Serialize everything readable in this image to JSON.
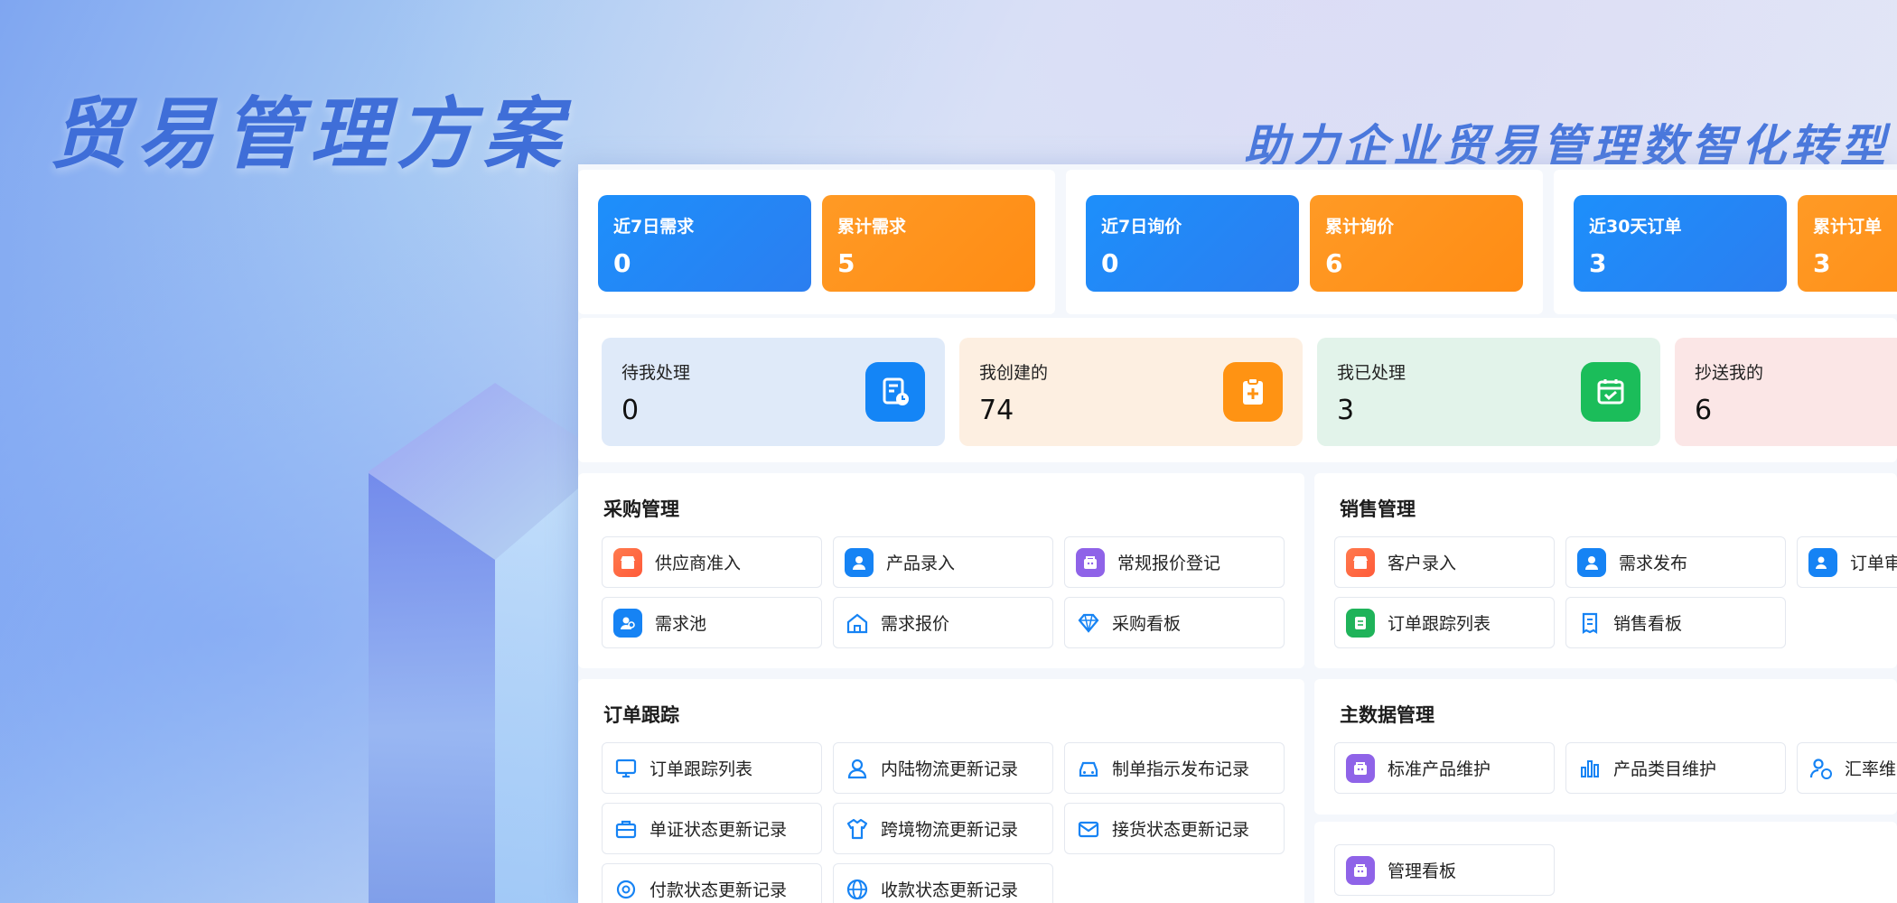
{
  "hero": {
    "title": "贸易管理方案",
    "subtitle": "助力企业贸易管理数智化转型"
  },
  "stats": [
    {
      "label": "近7日需求",
      "value": "0",
      "color": "#1d8ffb"
    },
    {
      "label": "累计需求",
      "value": "5",
      "color": "#ff9a25"
    },
    {
      "label": "近7日询价",
      "value": "0",
      "color": "#1d8ffb"
    },
    {
      "label": "累计询价",
      "value": "6",
      "color": "#ff9a25"
    },
    {
      "label": "近30天订单",
      "value": "3",
      "color": "#1d8ffb"
    },
    {
      "label": "累计订单",
      "value": "3",
      "color": "#ff9a25"
    }
  ],
  "tasks": [
    {
      "label": "待我处理",
      "value": "0",
      "icon": "document-clock-icon"
    },
    {
      "label": "我创建的",
      "value": "74",
      "icon": "clipboard-plus-icon"
    },
    {
      "label": "我已处理",
      "value": "3",
      "icon": "calendar-check-icon"
    },
    {
      "label": "抄送我的",
      "value": "6",
      "icon": ""
    }
  ],
  "procurement": {
    "title": "采购管理",
    "items": [
      {
        "label": "供应商准入",
        "icon": "store-icon"
      },
      {
        "label": "产品录入",
        "icon": "user-icon"
      },
      {
        "label": "常规报价登记",
        "icon": "bag-icon"
      },
      {
        "label": "需求池",
        "icon": "users-icon"
      },
      {
        "label": "需求报价",
        "icon": "home-icon"
      },
      {
        "label": "采购看板",
        "icon": "diamond-icon"
      }
    ]
  },
  "sales": {
    "title": "销售管理",
    "items": [
      {
        "label": "客户录入",
        "icon": "store-icon"
      },
      {
        "label": "需求发布",
        "icon": "user-icon"
      },
      {
        "label": "订单审",
        "icon": "users-icon"
      },
      {
        "label": "订单跟踪列表",
        "icon": "document-icon"
      },
      {
        "label": "销售看板",
        "icon": "receipt-icon"
      }
    ]
  },
  "order_tracking": {
    "title": "订单跟踪",
    "items": [
      {
        "label": "订单跟踪列表",
        "icon": "monitor-icon"
      },
      {
        "label": "内陆物流更新记录",
        "icon": "user-outline-icon"
      },
      {
        "label": "制单指示发布记录",
        "icon": "car-icon"
      },
      {
        "label": "单证状态更新记录",
        "icon": "briefcase-icon"
      },
      {
        "label": "跨境物流更新记录",
        "icon": "shirt-icon"
      },
      {
        "label": "接货状态更新记录",
        "icon": "mail-icon"
      },
      {
        "label": "付款状态更新记录",
        "icon": "payment-icon"
      },
      {
        "label": "收款状态更新记录",
        "icon": "globe-icon"
      }
    ]
  },
  "master_data": {
    "title": "主数据管理",
    "items": [
      {
        "label": "标准产品维护",
        "icon": "bag-icon"
      },
      {
        "label": "产品类目维护",
        "icon": "bar-chart-icon"
      },
      {
        "label": "汇率维",
        "icon": "person-currency-icon"
      },
      {
        "label": "管理看板",
        "icon": "bag-icon"
      }
    ]
  }
}
